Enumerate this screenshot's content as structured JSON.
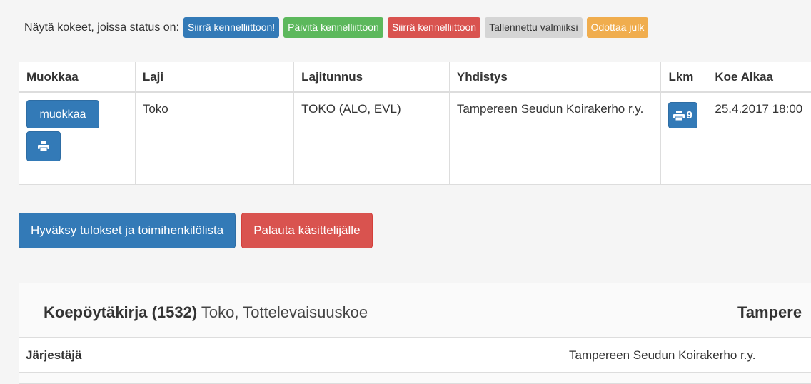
{
  "filter": {
    "label": "Näytä kokeet, joissa status on:",
    "badges": [
      {
        "label": "Siirrä kennelliittoon!",
        "color": "#337ab7"
      },
      {
        "label": "Päivitä kennelliittoon",
        "color": "#5cb85c"
      },
      {
        "label": "Siirrä kennelliittoon",
        "color": "#d9534f"
      },
      {
        "label": "Tallennettu valmiiksi",
        "color": "#d5d5d5"
      },
      {
        "label": "Odottaa julk",
        "color": "#f0ad4e"
      }
    ]
  },
  "table": {
    "headers": [
      "Muokkaa",
      "Laji",
      "Lajitunnus",
      "Yhdistys",
      "Lkm",
      "Koe Alkaa"
    ],
    "row": {
      "edit_label": "muokkaa",
      "print_icon": "printer-icon",
      "laji": "Toko",
      "lajitunnus": "TOKO (ALO, EVL)",
      "yhdistys": "Tampereen Seudun Koirakerho r.y.",
      "lkm": "9",
      "koe_alkaa": "25.4.2017 18:00"
    }
  },
  "actions": {
    "approve_label": "Hyväksy tulokset ja toimihenkilölista",
    "return_label": "Palauta käsittelijälle"
  },
  "panel": {
    "title_strong": "Koepöytäkirja (1532)",
    "title_light": "Toko, Tottelevaisuuskoe",
    "right_text": "Tampere",
    "info_label": "Järjestäjä",
    "info_value": "Tampereen Seudun Koirakerho r.y."
  }
}
